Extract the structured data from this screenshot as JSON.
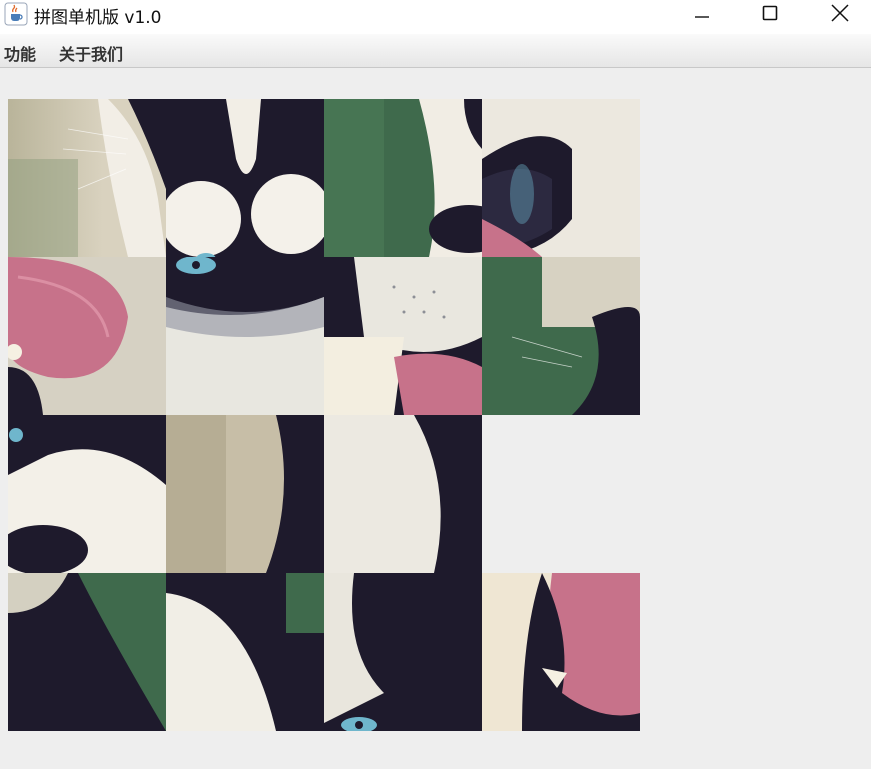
{
  "window": {
    "title": "拼图单机版 v1.0",
    "icon": "java-cup-icon",
    "controls": [
      "minimize-icon",
      "maximize-icon",
      "close-icon"
    ]
  },
  "menu": {
    "items": [
      {
        "label": "功能"
      },
      {
        "label": "关于我们"
      }
    ]
  },
  "puzzle": {
    "grid": [
      4,
      4
    ],
    "empty_cell": {
      "row": 3,
      "col": 4
    },
    "image": "husky dog face",
    "tiles": [
      {
        "row": 1,
        "col": 1,
        "name": "tile-1-1"
      },
      {
        "row": 1,
        "col": 2,
        "name": "tile-1-2"
      },
      {
        "row": 1,
        "col": 3,
        "name": "tile-1-3"
      },
      {
        "row": 1,
        "col": 4,
        "name": "tile-1-4"
      },
      {
        "row": 2,
        "col": 1,
        "name": "tile-2-1"
      },
      {
        "row": 2,
        "col": 2,
        "name": "tile-2-2"
      },
      {
        "row": 2,
        "col": 3,
        "name": "tile-2-3"
      },
      {
        "row": 2,
        "col": 4,
        "name": "tile-2-4"
      },
      {
        "row": 3,
        "col": 1,
        "name": "tile-3-1"
      },
      {
        "row": 3,
        "col": 2,
        "name": "tile-3-2"
      },
      {
        "row": 3,
        "col": 3,
        "name": "tile-3-3"
      },
      {
        "row": 4,
        "col": 1,
        "name": "tile-4-1"
      },
      {
        "row": 4,
        "col": 2,
        "name": "tile-4-2"
      },
      {
        "row": 4,
        "col": 3,
        "name": "tile-4-3"
      },
      {
        "row": 4,
        "col": 4,
        "name": "tile-4-4"
      }
    ]
  },
  "colors": {
    "fur_dark": "#1f1b2e",
    "fur_light": "#eeeae0",
    "tongue": "#c7728a",
    "eye": "#6fb6cc",
    "background_green": "#3f6a4c"
  }
}
